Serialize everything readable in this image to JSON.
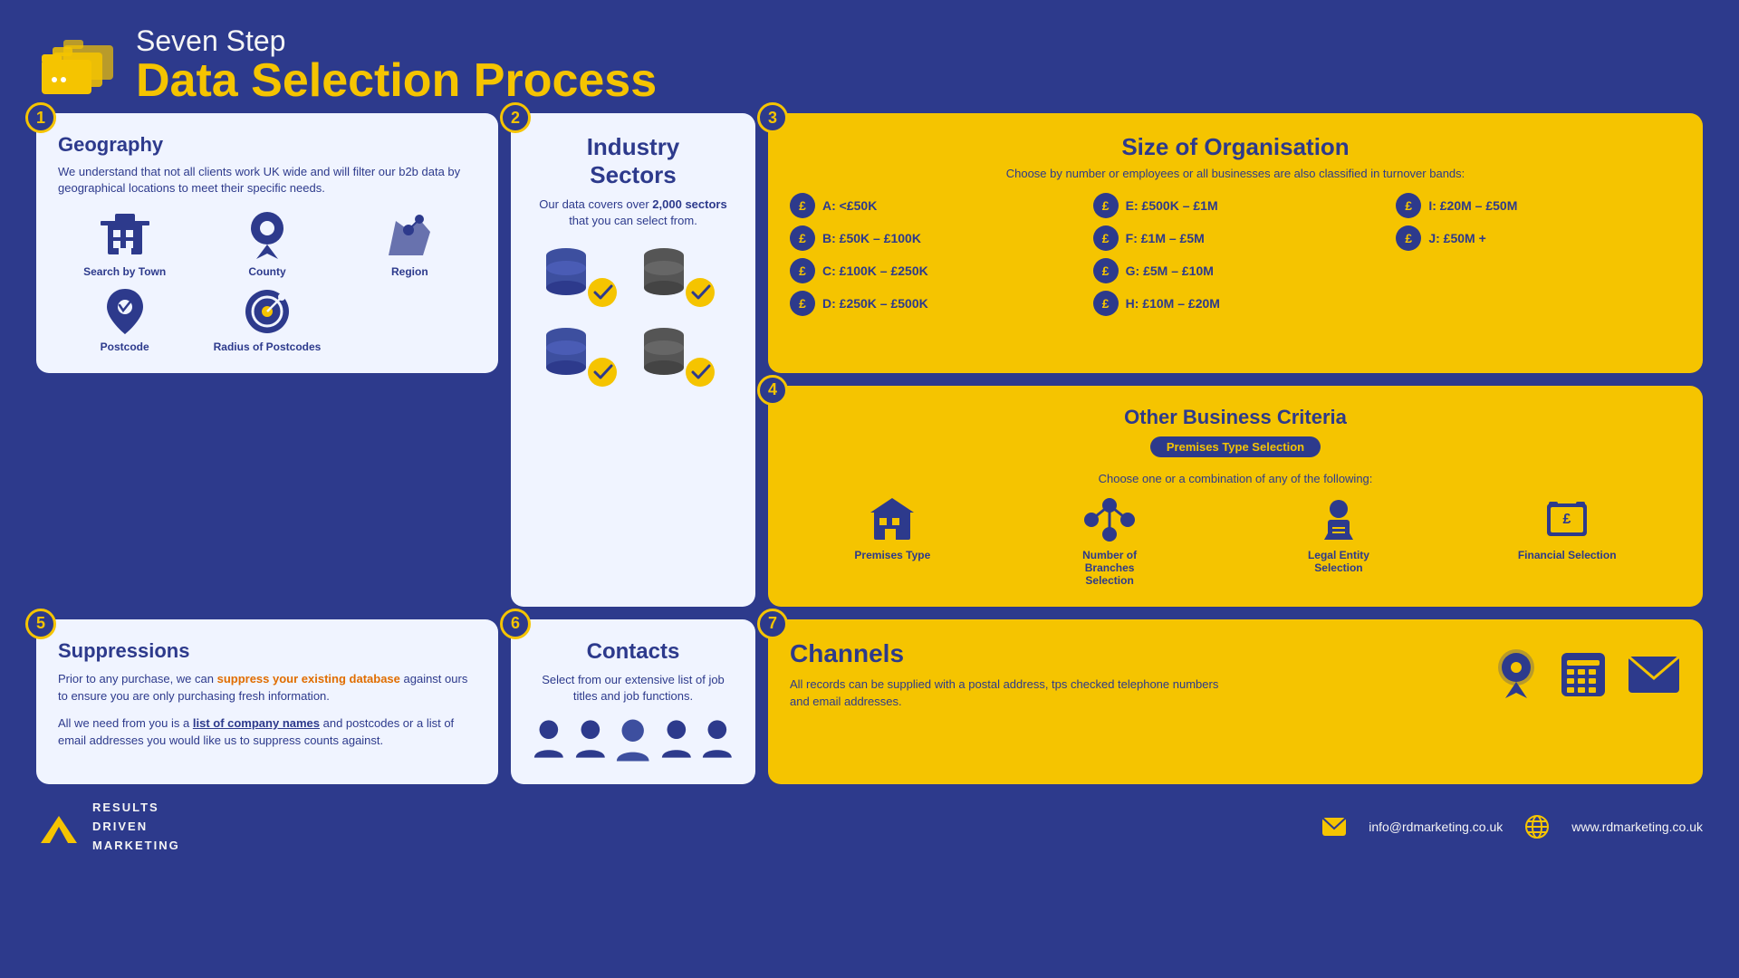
{
  "header": {
    "subtitle": "Seven Step",
    "title": "Data Selection Process"
  },
  "steps": {
    "step1": {
      "number": "1",
      "title": "Geography",
      "description": "We understand that not all clients work UK wide and will filter our b2b data by geographical locations to meet their specific needs.",
      "icons": [
        {
          "label": "Search by Town",
          "type": "building"
        },
        {
          "label": "County",
          "type": "location"
        },
        {
          "label": "Region",
          "type": "region"
        },
        {
          "label": "Postcode",
          "type": "postcode"
        },
        {
          "label": "Radius of Postcodes",
          "type": "radius"
        }
      ]
    },
    "step2": {
      "number": "2",
      "title": "Industry Sectors",
      "description": "Our data covers over 2,000 sectors that you can select from.",
      "strong": "2,000"
    },
    "step3": {
      "number": "3",
      "title": "Size of Organisation",
      "subtitle": "Choose by number or employees or all businesses are also classified in turnover bands:",
      "items": [
        {
          "label": "A: <£50K"
        },
        {
          "label": "E: £500K – £1M"
        },
        {
          "label": "I: £20M – £50M"
        },
        {
          "label": "B: £50K – £100K"
        },
        {
          "label": "F: £1M – £5M"
        },
        {
          "label": "J: £50M +"
        },
        {
          "label": "C: £100K – £250K"
        },
        {
          "label": "G: £5M – £10M"
        },
        {
          "label": ""
        },
        {
          "label": "D: £250K – £500K"
        },
        {
          "label": "H: £10M – £20M"
        },
        {
          "label": ""
        }
      ]
    },
    "step4": {
      "number": "4",
      "title": "Other Business Criteria",
      "badge": "Premises Type Selection",
      "subtitle": "Choose one or a combination of any of the following:",
      "criteria": [
        {
          "label": "Premises Type",
          "type": "building"
        },
        {
          "label": "Number of Branches Selection",
          "type": "branches"
        },
        {
          "label": "Legal Entity Selection",
          "type": "legal"
        },
        {
          "label": "Financial Selection",
          "type": "financial"
        }
      ]
    },
    "step5": {
      "number": "5",
      "title": "Suppressions",
      "para1": "Prior to any purchase, we can suppress your existing database against ours to ensure you are only purchasing fresh information.",
      "para1_highlight": "suppress your existing database",
      "para2_pre": "All we need from you is a ",
      "para2_link": "list of company names",
      "para2_post": " and postcodes or a list of email addresses you would like us to suppress counts against."
    },
    "step6": {
      "number": "6",
      "title": "Contacts",
      "description": "Select from our extensive list of job titles and job functions."
    },
    "step7": {
      "number": "7",
      "title": "Channels",
      "description": "All records can be supplied with a postal address, tps checked telephone numbers and email addresses."
    }
  },
  "footer": {
    "logo_lines": [
      "RESULTS",
      "DRIVEN",
      "MARKETING"
    ],
    "email": "info@rdmarketing.co.uk",
    "website": "www.rdmarketing.co.uk"
  }
}
